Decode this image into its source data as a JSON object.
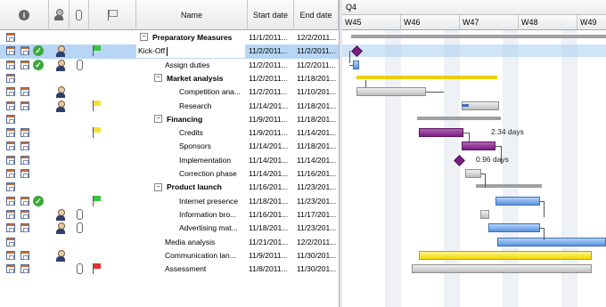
{
  "columns": {
    "info_icon": "info-icon",
    "name": "Name",
    "start": "Start date",
    "end": "End date"
  },
  "rows": [
    {
      "name": "Preparatory Measures",
      "start": "11/1/2011...",
      "end": "12/2/2011...",
      "bold": true,
      "toggle": "−",
      "indent": 0,
      "icons": {
        "check": false,
        "person": false,
        "clip": false,
        "flag": ""
      }
    },
    {
      "name": "Kick-Off",
      "start": "11/2/2011...",
      "end": "11/2/2011...",
      "bold": false,
      "toggle": "",
      "indent": 0,
      "editing": true,
      "selected": true,
      "icons": {
        "check": true,
        "person": true,
        "clip": false,
        "flag": "green"
      }
    },
    {
      "name": "Assign duties",
      "start": "11/2/2011...",
      "end": "11/2/2011...",
      "bold": false,
      "toggle": "",
      "indent": 1,
      "icons": {
        "check": true,
        "person": true,
        "clip": true,
        "flag": ""
      }
    },
    {
      "name": "Market analysis",
      "start": "11/2/2011...",
      "end": "11/18/201...",
      "bold": true,
      "toggle": "−",
      "indent": 1,
      "icons": {
        "check": false,
        "person": false,
        "clip": false,
        "flag": ""
      }
    },
    {
      "name": "Competition ana...",
      "start": "11/2/2011...",
      "end": "11/10/201...",
      "bold": false,
      "toggle": "",
      "indent": 2,
      "icons": {
        "check": false,
        "person": true,
        "clip": false,
        "flag": ""
      }
    },
    {
      "name": "Research",
      "start": "11/14/201...",
      "end": "11/18/201...",
      "bold": false,
      "toggle": "",
      "indent": 2,
      "icons": {
        "check": false,
        "person": true,
        "clip": false,
        "flag": "yellow"
      }
    },
    {
      "name": "Financing",
      "start": "11/9/2011...",
      "end": "11/18/201...",
      "bold": true,
      "toggle": "−",
      "indent": 1,
      "icons": {
        "check": false,
        "person": false,
        "clip": false,
        "flag": ""
      }
    },
    {
      "name": "Credits",
      "start": "11/9/2011...",
      "end": "11/14/201...",
      "bold": false,
      "toggle": "",
      "indent": 2,
      "icons": {
        "check": false,
        "person": false,
        "clip": false,
        "flag": "yellow"
      }
    },
    {
      "name": "Sponsors",
      "start": "11/14/201...",
      "end": "11/18/201...",
      "bold": false,
      "toggle": "",
      "indent": 2,
      "icons": {
        "check": false,
        "person": false,
        "clip": false,
        "flag": ""
      }
    },
    {
      "name": "Implementation",
      "start": "11/14/201...",
      "end": "11/14/201...",
      "bold": false,
      "toggle": "",
      "indent": 2,
      "icons": {
        "check": false,
        "person": false,
        "clip": false,
        "flag": ""
      }
    },
    {
      "name": "Correction phase",
      "start": "11/14/201...",
      "end": "11/16/201...",
      "bold": false,
      "toggle": "",
      "indent": 2,
      "icons": {
        "check": false,
        "person": false,
        "clip": false,
        "flag": ""
      }
    },
    {
      "name": "Product launch",
      "start": "11/16/201...",
      "end": "11/23/201...",
      "bold": true,
      "toggle": "−",
      "indent": 1,
      "icons": {
        "check": false,
        "person": false,
        "clip": false,
        "flag": ""
      }
    },
    {
      "name": "Internet presence",
      "start": "11/18/201...",
      "end": "11/23/201...",
      "bold": false,
      "toggle": "",
      "indent": 2,
      "icons": {
        "check": true,
        "person": false,
        "clip": false,
        "flag": "green"
      }
    },
    {
      "name": "Information bro...",
      "start": "11/16/201...",
      "end": "11/17/201...",
      "bold": false,
      "toggle": "",
      "indent": 2,
      "icons": {
        "check": false,
        "person": true,
        "clip": true,
        "flag": ""
      }
    },
    {
      "name": "Advertising mat...",
      "start": "11/18/201...",
      "end": "11/23/201...",
      "bold": false,
      "toggle": "",
      "indent": 2,
      "icons": {
        "check": false,
        "person": true,
        "clip": true,
        "flag": ""
      }
    },
    {
      "name": "Media analysis",
      "start": "11/21/201...",
      "end": "12/2/2011...",
      "bold": false,
      "toggle": "",
      "indent": 1,
      "icons": {
        "check": false,
        "person": false,
        "clip": false,
        "flag": ""
      }
    },
    {
      "name": "Communication lan...",
      "start": "11/9/2011...",
      "end": "11/30/201...",
      "bold": false,
      "toggle": "",
      "indent": 1,
      "icons": {
        "check": false,
        "person": true,
        "clip": false,
        "flag": ""
      }
    },
    {
      "name": "Assessment",
      "start": "11/8/2011...",
      "end": "11/30/201...",
      "bold": false,
      "toggle": "",
      "indent": 1,
      "icons": {
        "check": false,
        "person": false,
        "clip": true,
        "flag": "red"
      }
    }
  ],
  "gantt": {
    "quarter": "Q4",
    "weeks": [
      "W45",
      "W46",
      "W47",
      "W48",
      "W49"
    ],
    "labels": {
      "credits_lag": "2.34 days",
      "implementation_lag": "0.96 days"
    }
  }
}
